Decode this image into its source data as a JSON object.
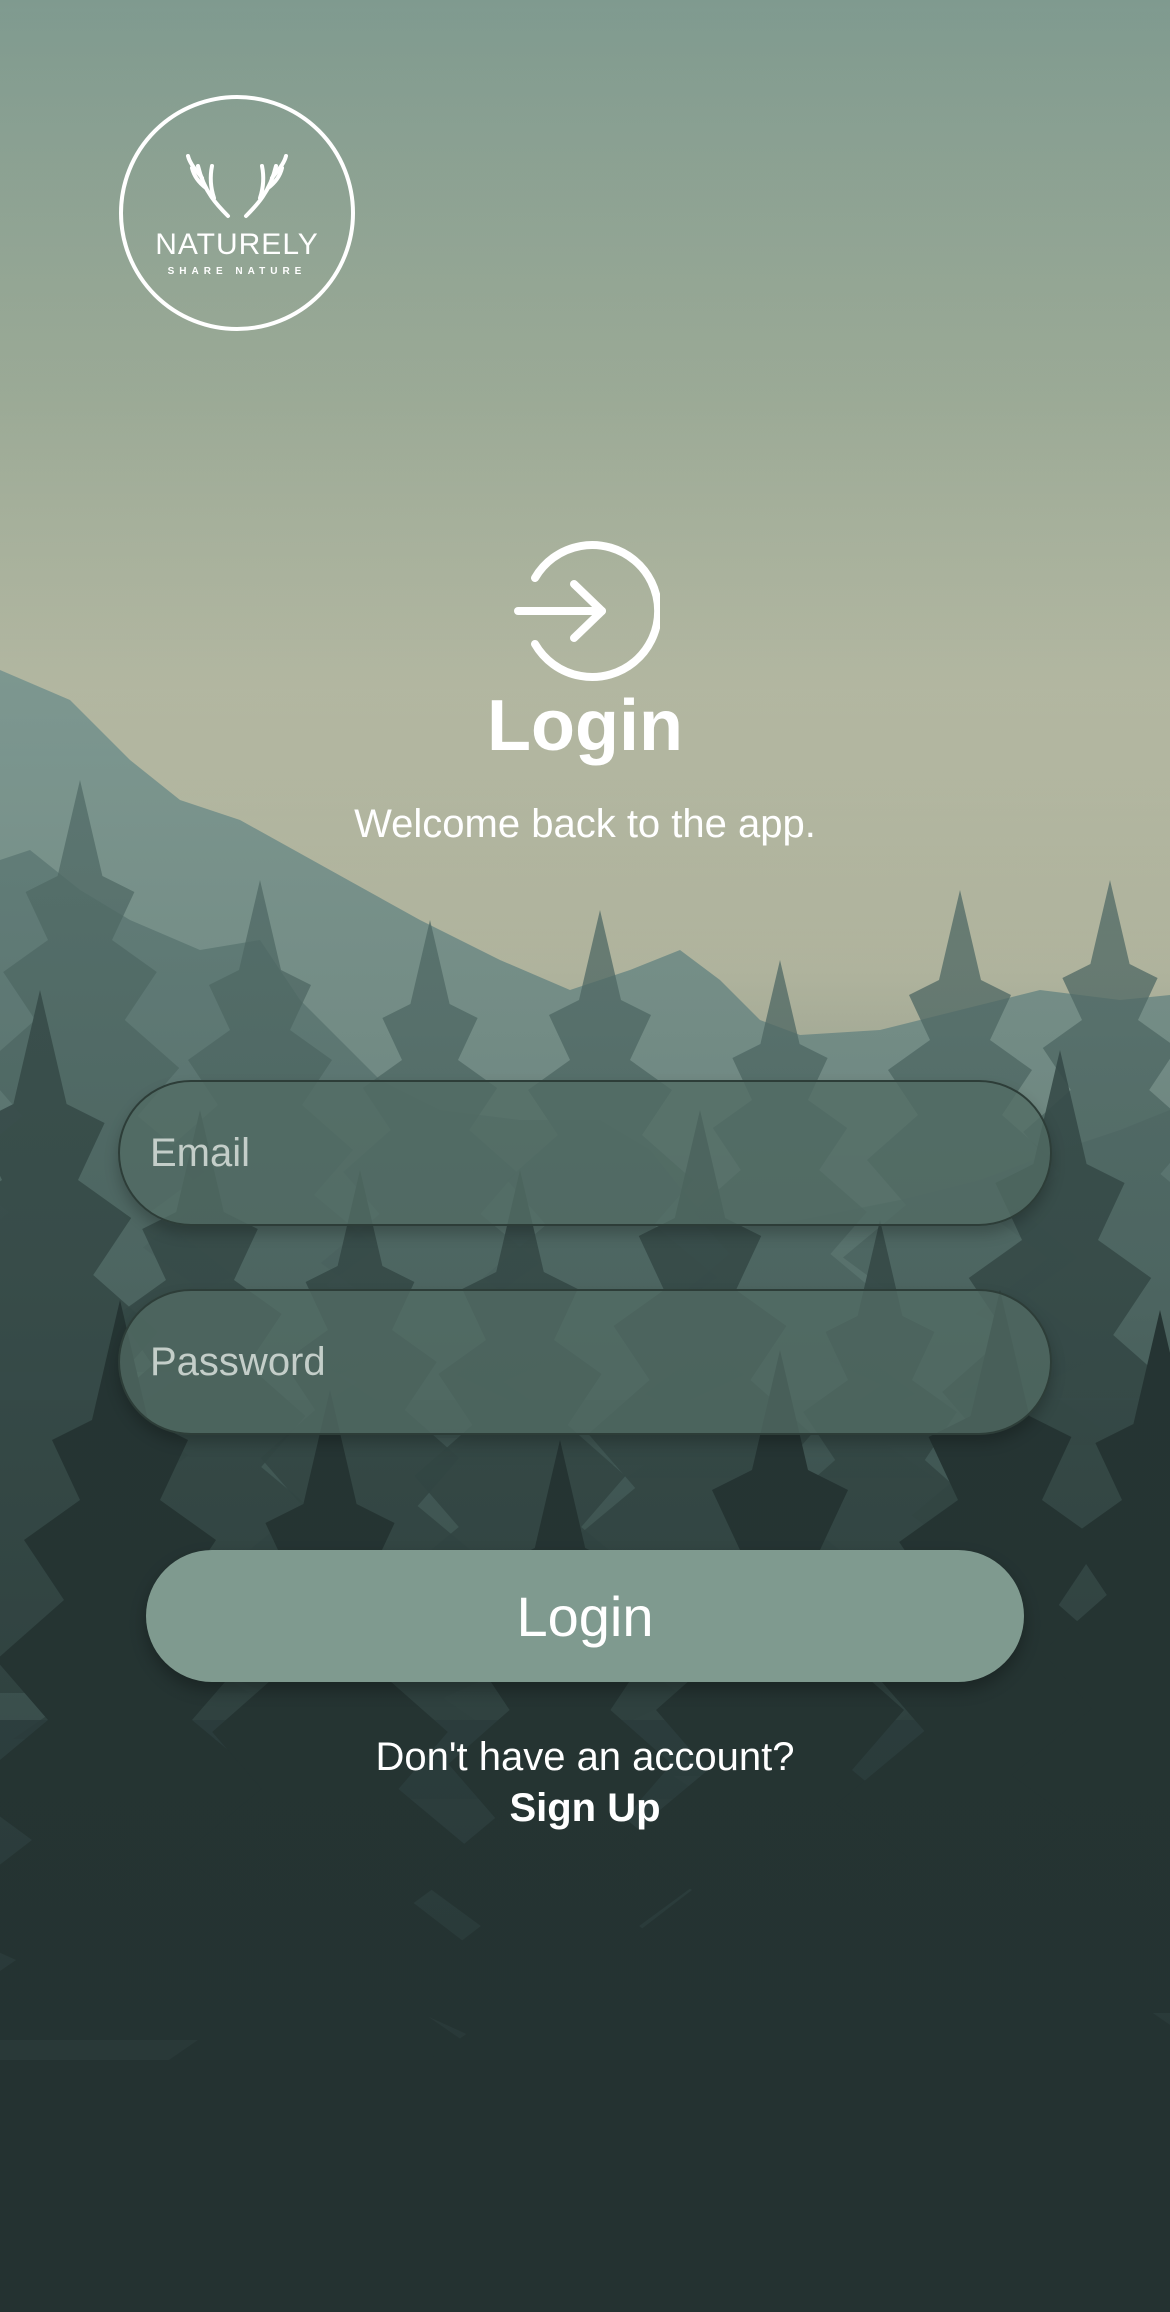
{
  "brand": {
    "name": "NATURELY",
    "tagline": "SHARE NATURE",
    "logo_icon": "antlers-logo-icon"
  },
  "header": {
    "icon": "login-arrow-icon",
    "title": "Login",
    "subtitle": "Welcome back to the app."
  },
  "form": {
    "email_placeholder": "Email",
    "email_value": "",
    "password_placeholder": "Password",
    "password_value": "",
    "submit_label": "Login"
  },
  "footer": {
    "prompt": "Don't have an account?",
    "signup_label": "Sign Up"
  },
  "colors": {
    "sky_top": "#7f9a8f",
    "sky_horizon": "#dde0c4",
    "ground_dark": "#243231",
    "button_bg": "#7f9a8f",
    "field_bg": "#526c64"
  }
}
